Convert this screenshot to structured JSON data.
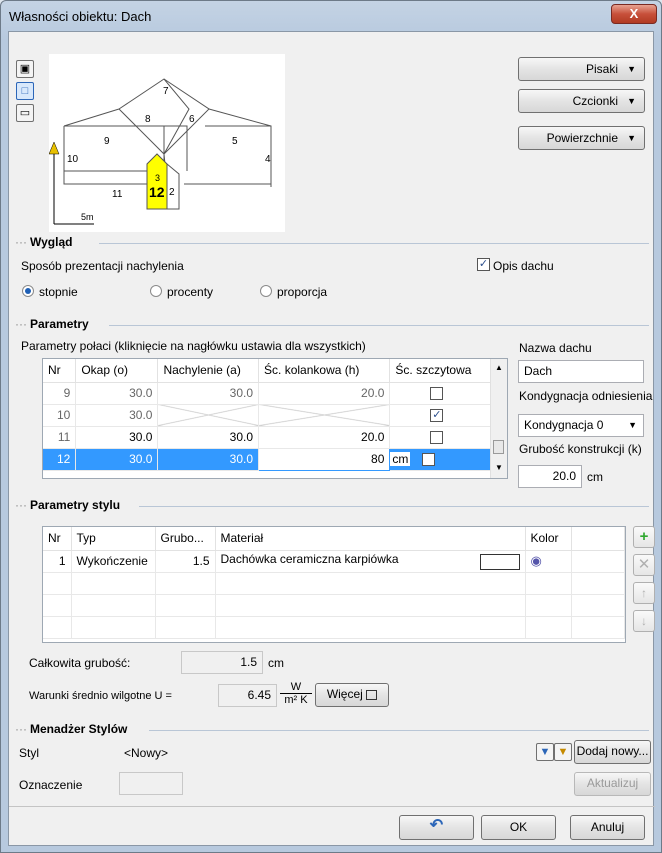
{
  "window": {
    "title_prefix": "Własności obiektu:",
    "title_name": "Dach",
    "close_label": "X"
  },
  "preview": {
    "labels": [
      "7",
      "8",
      "6",
      "9",
      "5",
      "10",
      "4",
      "11",
      "12",
      "2",
      "3"
    ],
    "scale": "5m",
    "selected": "12"
  },
  "right_buttons": {
    "pens": "Pisaki",
    "fonts": "Czcionki",
    "surfaces": "Powierzchnie"
  },
  "appearance": {
    "title": "Wygląd",
    "slope_label": "Sposób prezentacji nachylenia",
    "options": [
      "stopnie",
      "procenty",
      "proporcja"
    ],
    "selected": "stopnie",
    "roof_desc_label": "Opis dachu",
    "roof_desc_checked": true
  },
  "parameters": {
    "title": "Parametry",
    "hint": "Parametry połaci (kliknięcie na nagłówku ustawia dla wszystkich)",
    "columns": [
      "Nr",
      "Okap (o)",
      "Nachylenie (a)",
      "Śc. kolankowa (h)",
      "Śc. szczytowa"
    ],
    "rows": [
      {
        "nr": "9",
        "okap": "30.0",
        "slope": "30.0",
        "wall": "20.0",
        "gable": false
      },
      {
        "nr": "10",
        "okap": "30.0",
        "slope": "",
        "wall": "",
        "gable": true
      },
      {
        "nr": "11",
        "okap": "30.0",
        "slope": "30.0",
        "wall": "20.0",
        "gable": false
      },
      {
        "nr": "12",
        "okap": "30.0",
        "slope": "30.0",
        "wall": "80",
        "gable": false
      }
    ],
    "edit_unit": "cm",
    "roof_name_label": "Nazwa dachu",
    "roof_name": "Dach",
    "ref_floor_label": "Kondygnacja odniesienia",
    "ref_floor": "Kondygnacja 0",
    "thickness_label": "Grubość konstrukcji (k)",
    "thickness": "20.0",
    "thickness_unit": "cm"
  },
  "style_params": {
    "title": "Parametry stylu",
    "columns": [
      "Nr",
      "Typ",
      "Grubo...",
      "Materiał",
      "Kolor"
    ],
    "rows": [
      {
        "nr": "1",
        "type": "Wykończenie",
        "thickness": "1.5",
        "material": "Dachówka ceramiczna karpiówka"
      }
    ],
    "total_label": "Całkowita grubość:",
    "total_value": "1.5",
    "total_unit": "cm",
    "u_label": "Warunki średnio wilgotne U =",
    "u_value": "6.45",
    "u_unit_top": "W",
    "u_unit_bottom": "m² K",
    "more": "Więcej"
  },
  "style_manager": {
    "title": "Menadżer Stylów",
    "style_label": "Styl",
    "style_value": "<Nowy>",
    "add_new": "Dodaj nowy...",
    "mark_label": "Oznaczenie",
    "mark_value": "",
    "update": "Aktualizuj"
  },
  "footer": {
    "ok": "OK",
    "cancel": "Anuluj"
  }
}
